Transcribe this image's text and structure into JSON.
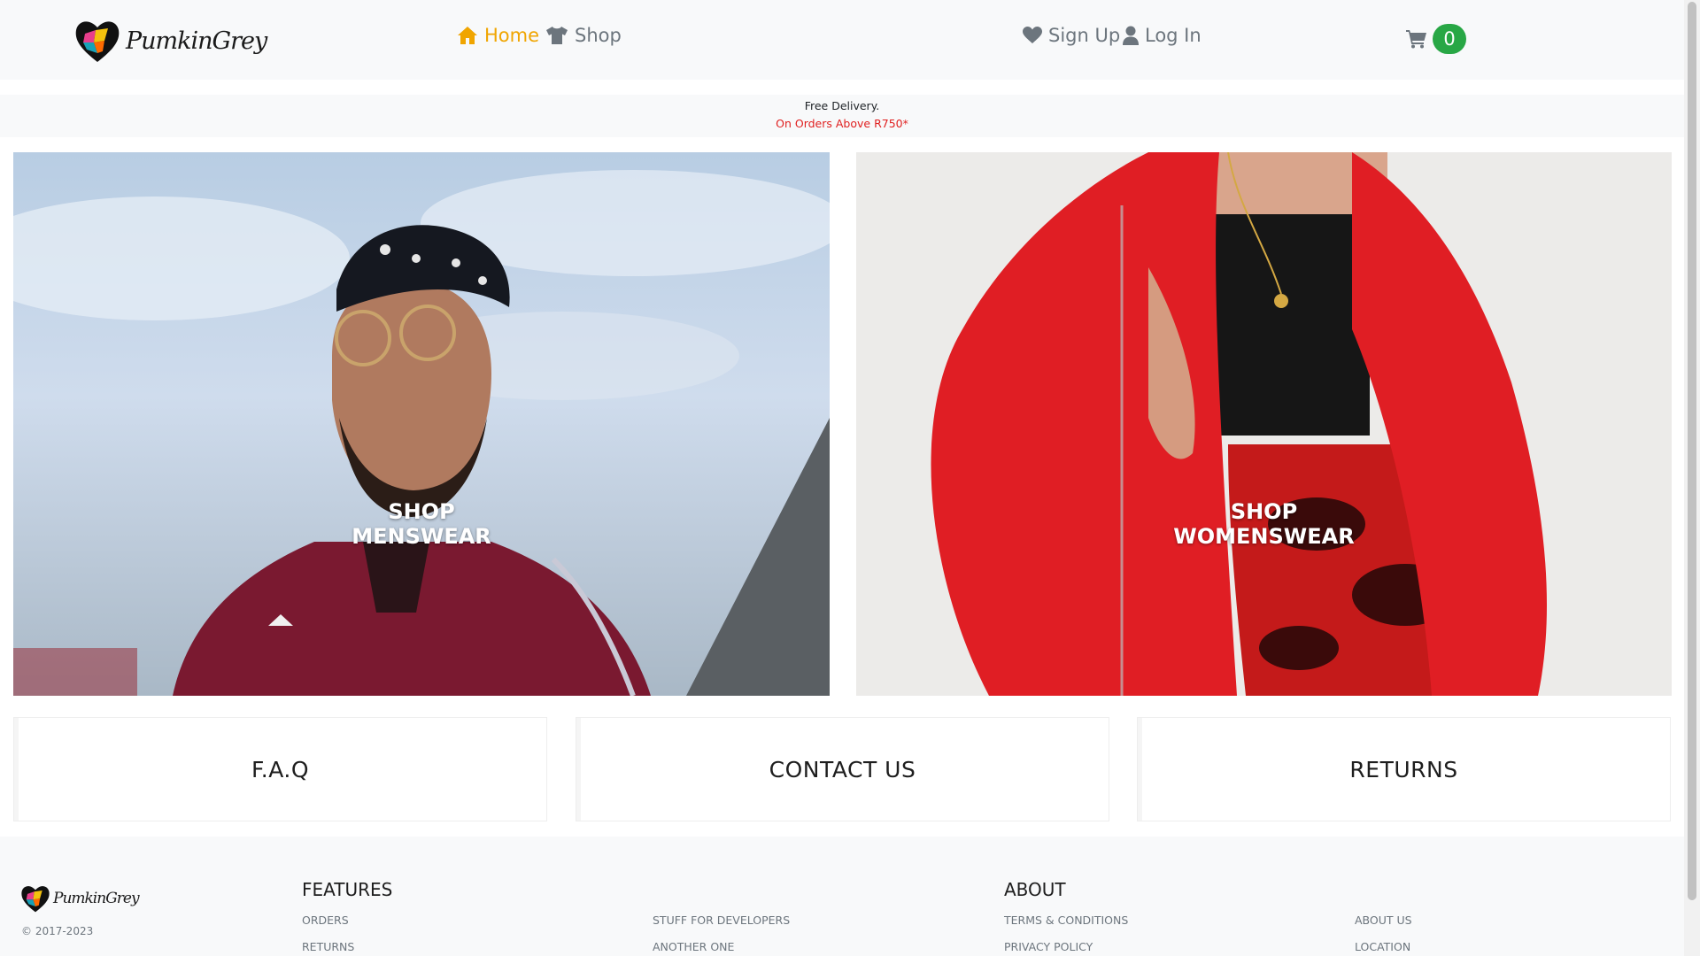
{
  "brand": {
    "name": "PumkinGrey",
    "logo_icon": "heart-logo-icon"
  },
  "nav": {
    "home_label": "Home",
    "shop_label": "Shop",
    "signup_label": "Sign Up",
    "login_label": "Log In",
    "cart_count": "0",
    "accent_color": "#f0a500",
    "badge_color": "#28a745"
  },
  "promo": {
    "line1": "Free Delivery.",
    "line2": "On Orders Above R750*"
  },
  "hero": {
    "men_line1": "SHOP",
    "men_line2": "MENSWEAR",
    "women_line1": "SHOP",
    "women_line2": "WOMENSWEAR"
  },
  "cards": {
    "faq": "F.A.Q",
    "contact": "CONTACT US",
    "returns": "RETURNS"
  },
  "footer": {
    "copyright": "© 2017-2023",
    "features_heading": "FEATURES",
    "about_heading": "ABOUT",
    "links": {
      "orders": "ORDERS",
      "returns": "RETURNS",
      "developers": "STUFF FOR DEVELOPERS",
      "another": "ANOTHER ONE",
      "terms": "TERMS & CONDITIONS",
      "privacy": "PRIVACY POLICY",
      "about_us": "ABOUT US",
      "location": "LOCATION"
    }
  }
}
